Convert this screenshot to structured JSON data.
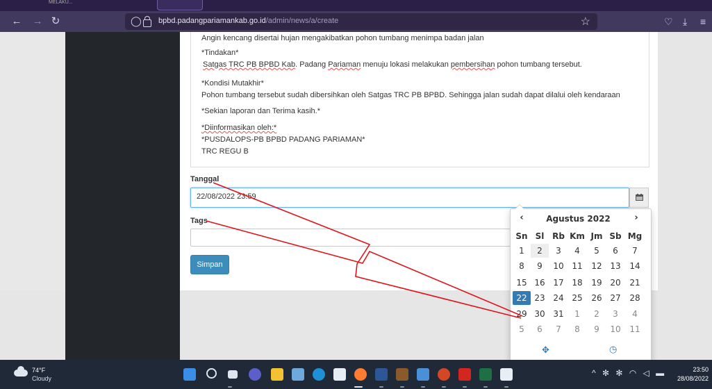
{
  "browser": {
    "url_host": "bpbd.padangpariamankab.go.id",
    "url_path": "/admin/news/a/create",
    "top_tab_text": "MELAKU..."
  },
  "editor": {
    "line1": "Angin kencang disertai hujan mengakibatkan pohon tumbang menimpa badan jalan",
    "tindakan_heading": "*Tindakan*",
    "tindakan_body_parts": [
      "Satgas TRC PB BPBD Kab",
      ". Padang ",
      "Pariaman",
      " menuju lokasi melakukan ",
      "pembersihan",
      " pohon tumbang tersebut."
    ],
    "kondisi_heading": "*Kondisi Mutakhir*",
    "kondisi_body": "Pohon tumbang tersebut sudah dibersihkan oleh Satgas TRC PB BPBD. Sehingga jalan sudah dapat dilalui oleh kendaraan",
    "closing": "*Sekian laporan dan Terima kasih.*",
    "info_heading": "*Diinformasikan oleh:*",
    "info_org": "*PUSDALOPS-PB BPBD PADANG PARIAMAN*",
    "info_team": "TRC REGU B"
  },
  "form": {
    "tanggal_label": "Tanggal",
    "tanggal_value": "22/08/2022 23:59",
    "tags_label": "Tags",
    "tags_value": "",
    "submit_label": "Simpan"
  },
  "datepicker": {
    "month_label": "Agustus 2022",
    "prev": "‹",
    "next": "›",
    "weekdays": [
      "Sn",
      "Sl",
      "Rb",
      "Km",
      "Jm",
      "Sb",
      "Mg"
    ],
    "weeks": [
      [
        "1",
        "2",
        "3",
        "4",
        "5",
        "6",
        "7"
      ],
      [
        "8",
        "9",
        "10",
        "11",
        "12",
        "13",
        "14"
      ],
      [
        "15",
        "16",
        "17",
        "18",
        "19",
        "20",
        "21"
      ],
      [
        "22",
        "23",
        "24",
        "25",
        "26",
        "27",
        "28"
      ],
      [
        "29",
        "30",
        "31",
        "1",
        "2",
        "3",
        "4"
      ],
      [
        "5",
        "6",
        "7",
        "8",
        "9",
        "10",
        "11"
      ]
    ],
    "selected_day": "22",
    "today_day": "2",
    "accent": "#337ab7"
  },
  "taskbar": {
    "temperature": "74°F",
    "condition": "Cloudy",
    "time": "23:50",
    "date": "28/08/2022"
  },
  "annotation": {
    "color": "#e0141a"
  }
}
